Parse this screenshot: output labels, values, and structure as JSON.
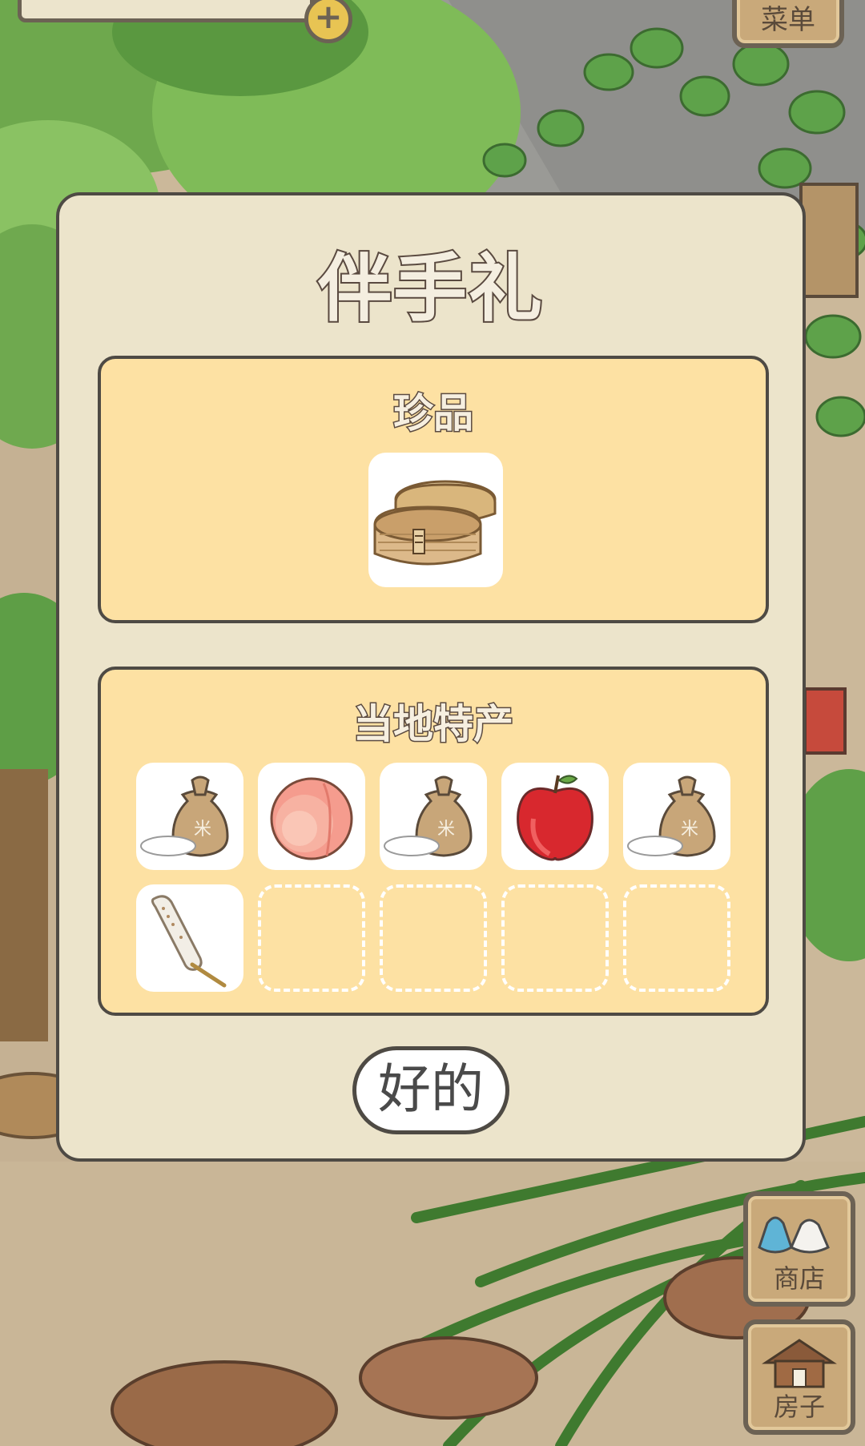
{
  "hud": {
    "plus_symbol": "+",
    "menu_label": "菜单"
  },
  "side": {
    "shop_label": "商店",
    "house_label": "房子"
  },
  "dialog": {
    "title": "伴手礼",
    "rare_section": {
      "title": "珍品",
      "item": "wooden-lunchbox-icon"
    },
    "local_section": {
      "title": "当地特产",
      "items": [
        "rice-bag-icon",
        "peach-icon",
        "rice-bag-icon",
        "apple-icon",
        "rice-bag-icon",
        "mochi-skewer-icon"
      ],
      "empty_slots": 4
    },
    "ok_label": "好的"
  },
  "colors": {
    "panel": "#fde1a3",
    "modal": "#ece4cb",
    "outline": "#4e4a44"
  }
}
